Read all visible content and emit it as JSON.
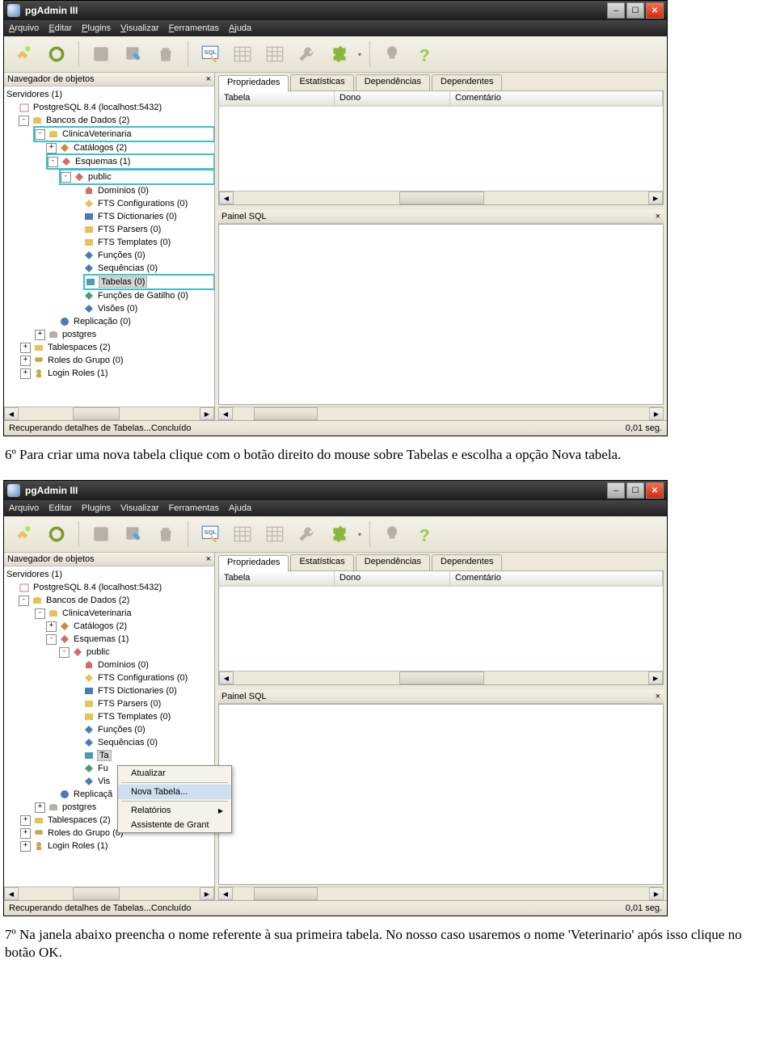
{
  "app_title": "pgAdmin III",
  "menus": [
    "Arquivo",
    "Editar",
    "Plugins",
    "Visualizar",
    "Ferramentas",
    "Ajuda"
  ],
  "menus_u": [
    "A",
    "E",
    "P",
    "V",
    "F",
    "A"
  ],
  "nav_title": "Navegador de objetos",
  "sql_title": "Painel SQL",
  "tabs": [
    "Propriedades",
    "Estatísticas",
    "Dependências",
    "Dependentes"
  ],
  "grid_cols": [
    "Tabela",
    "Dono",
    "Comentário"
  ],
  "tree": {
    "root": "Servidores (1)",
    "server": "PostgreSQL 8.4 (localhost:5432)",
    "dbgroup": "Bancos de Dados (2)",
    "db1": "ClinicaVeterinaria",
    "cat": "Catálogos (2)",
    "sch": "Esquemas (1)",
    "pub": "public",
    "dom": "Domínios (0)",
    "ftsc": "FTS Configurations (0)",
    "ftsd": "FTS Dictionaries (0)",
    "ftsp": "FTS Parsers (0)",
    "ftst": "FTS Templates (0)",
    "func": "Funções (0)",
    "seq": "Sequências (0)",
    "tab": "Tabelas (0)",
    "tab2_a": "Ta",
    "tab2_b": "belas (0)",
    "trig": "Funções de Gatilho (0)",
    "trig2_a": "Fu",
    "trig2_b": "nções de Gatilho (0)",
    "view": "Visões (0)",
    "view2_a": "Vis",
    "view2_b": "ões (0)",
    "rep": "Replicação (0)",
    "rep2_a": "Replicaçã",
    "rep2_b": "o (0)",
    "db2": "postgres",
    "ts": "Tablespaces (2)",
    "roles": "Roles do Grupo (0)",
    "login": "Login Roles (1)"
  },
  "ctx": {
    "refresh": "Atualizar",
    "newtable": "Nova Tabela...",
    "reports": "Relatórios",
    "grant": "Assistente de Grant"
  },
  "status_left": "Recuperando detalhes de Tabelas...Concluído",
  "status_right": "0,01 seg.",
  "doc_step6": "6º Para criar uma nova tabela clique com o botão direito do mouse sobre Tabelas e escolha a opção Nova tabela.",
  "doc_step7": "7º Na janela abaixo preencha o nome referente à sua primeira tabela. No nosso caso usaremos o nome 'Veterinario' após isso clique no botão OK."
}
